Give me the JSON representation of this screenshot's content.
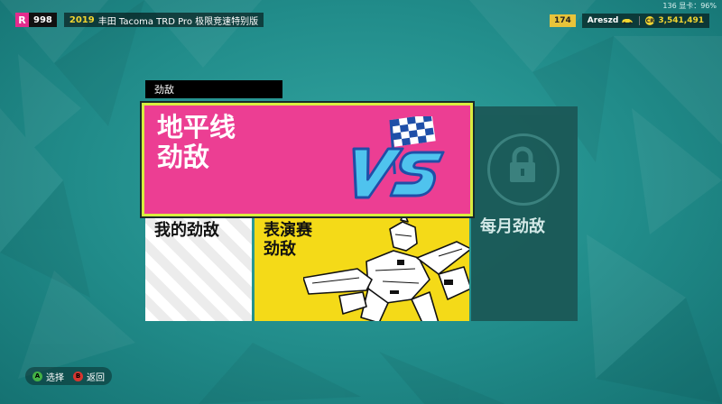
{
  "header": {
    "rank_letter": "R",
    "rank_value": "998",
    "car_year": "2019",
    "car_name": "丰田 Tacoma TRD Pro 极限竞速特别版",
    "stats_overlay": "136 显卡：96%",
    "level": "174",
    "player_name": "Areszd",
    "credit_symbol": "CR",
    "credits": "3,541,491"
  },
  "section": {
    "title": "劲敌"
  },
  "cards": {
    "horizon_rivals": "地平线\n劲敌",
    "my_rivals": "我的劲敌",
    "exhibition_rivals": "表演赛\n劲敌",
    "monthly_rivals": "每月劲敌"
  },
  "footer": {
    "a_key": "A",
    "select_label": "选择",
    "b_key": "B",
    "back_label": "返回"
  },
  "colors": {
    "background": "#218c8a",
    "pink": "#ec3e93",
    "yellow": "#f4da18",
    "highlight": "#d8ee3e",
    "locked": "#1b5957"
  }
}
